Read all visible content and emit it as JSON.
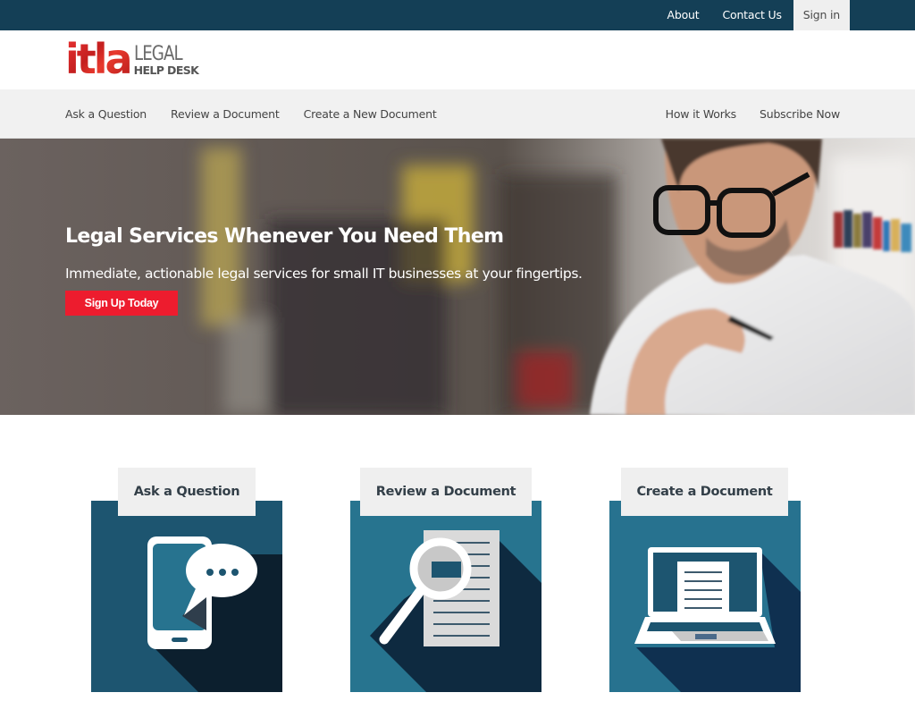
{
  "topbar": {
    "links": [
      {
        "label": "About"
      },
      {
        "label": "Contact Us"
      },
      {
        "label": "Sign in"
      }
    ]
  },
  "brand": {
    "logo_main": "itla",
    "logo_line1": "LEGAL",
    "logo_line2": "HELP DESK",
    "colors": {
      "primary_red": "#dc2a2a",
      "nav_dark": "#143f56",
      "cta_red": "#ed1c2e"
    }
  },
  "mainnav": {
    "left": [
      {
        "label": "Ask a Question"
      },
      {
        "label": "Review a Document"
      },
      {
        "label": "Create a New Document"
      }
    ],
    "right": [
      {
        "label": "How it Works"
      },
      {
        "label": "Subscribe Now"
      }
    ]
  },
  "hero": {
    "title": "Legal Services Whenever You Need Them",
    "subtitle": "Immediate, actionable legal services for small IT businesses at your fingertips.",
    "cta_label": "Sign Up Today"
  },
  "cards": [
    {
      "title": "Ask a Question",
      "icon": "smartphone-chat-icon",
      "color": "#1d5570"
    },
    {
      "title": "Review a Document",
      "icon": "magnifier-document-icon",
      "color": "#27748f"
    },
    {
      "title": "Create a Document",
      "icon": "laptop-document-icon",
      "color": "#27728f"
    }
  ]
}
